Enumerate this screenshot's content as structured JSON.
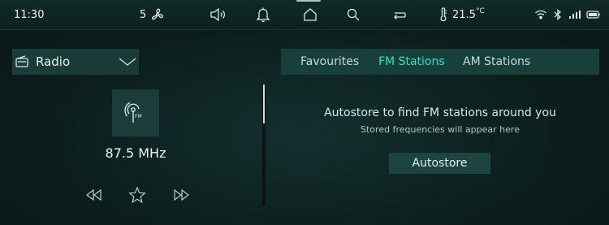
{
  "status_bar": {
    "time": "11:30",
    "fan_speed": "5",
    "fan_icon": "fan-icon",
    "volume_icon": "volume-icon",
    "notification_icon": "bell-icon",
    "home_icon": "home-icon",
    "search_icon": "search-icon",
    "repeat_icon": "repeat-icon",
    "temperature_icon": "thermometer-icon",
    "temperature": "21.5",
    "temperature_unit": "°C",
    "wifi_icon": "wifi-icon",
    "bluetooth_icon": "bluetooth-icon",
    "signal_icon": "signal-icon",
    "battery_icon": "battery-icon"
  },
  "source": {
    "label": "Radio",
    "icon": "radio-icon"
  },
  "player": {
    "band_icon": "fm-radio-icon",
    "band_text": "FM",
    "frequency": "87.5 MHz",
    "controls": {
      "previous_icon": "rewind-icon",
      "favourite_icon": "star-icon",
      "next_icon": "fast-forward-icon"
    }
  },
  "tabs": [
    {
      "label": "Favourites",
      "active": false
    },
    {
      "label": "FM Stations",
      "active": true
    },
    {
      "label": "AM Stations",
      "active": false
    }
  ],
  "content": {
    "title": "Autostore to find FM stations around you",
    "subtitle": "Stored frequencies will appear here",
    "autostore_label": "Autostore"
  },
  "colors": {
    "accent": "#2fe0c4",
    "background": "#0c1f1d",
    "panel": "#1a3c38"
  }
}
